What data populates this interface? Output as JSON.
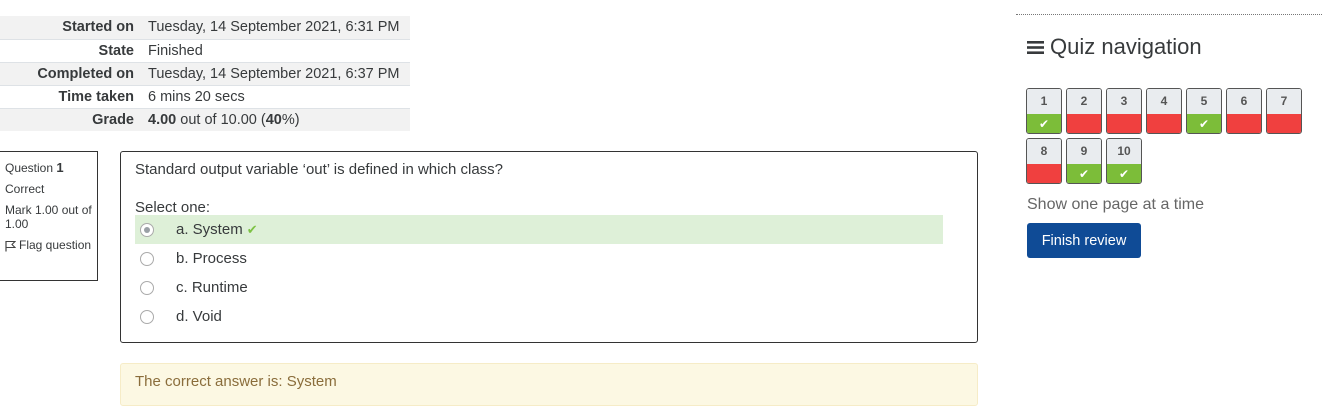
{
  "summary": [
    {
      "label": "Started on",
      "value": "Tuesday, 14 September 2021, 6:31 PM"
    },
    {
      "label": "State",
      "value": "Finished"
    },
    {
      "label": "Completed on",
      "value": "Tuesday, 14 September 2021, 6:37 PM"
    },
    {
      "label": "Time taken",
      "value": "6 mins 20 secs"
    },
    {
      "label": "Grade",
      "grade_score": "4.00",
      "grade_mid": " out of 10.00 (",
      "grade_percent": "40",
      "grade_end": "%)"
    }
  ],
  "question_info": {
    "question_word": "Question ",
    "number": "1",
    "state": "Correct",
    "mark": "Mark 1.00 out of 1.00",
    "flag": "Flag question"
  },
  "question": {
    "text": "Standard output variable ‘out’ is defined in which class?",
    "select_prompt": "Select one:",
    "answers": [
      {
        "label": "a. System",
        "selected": true,
        "correct": true
      },
      {
        "label": "b. Process",
        "selected": false,
        "correct": false
      },
      {
        "label": "c. Runtime",
        "selected": false,
        "correct": false
      },
      {
        "label": "d. Void",
        "selected": false,
        "correct": false
      }
    ],
    "feedback": "The correct answer is: System"
  },
  "nav": {
    "title": "Quiz navigation",
    "buttons": [
      {
        "num": "1",
        "state": "correct"
      },
      {
        "num": "2",
        "state": "incorrect"
      },
      {
        "num": "3",
        "state": "incorrect"
      },
      {
        "num": "4",
        "state": "incorrect"
      },
      {
        "num": "5",
        "state": "correct"
      },
      {
        "num": "6",
        "state": "incorrect"
      },
      {
        "num": "7",
        "state": "incorrect"
      },
      {
        "num": "8",
        "state": "incorrect"
      },
      {
        "num": "9",
        "state": "correct"
      },
      {
        "num": "10",
        "state": "correct"
      }
    ],
    "one_page": "Show one page at a time",
    "finish_label": "Finish review"
  },
  "colors": {
    "correct": "#7cbd39",
    "incorrect": "#f0403f",
    "primary": "#0f4b96",
    "correct_answer_bg": "#def0d8"
  }
}
